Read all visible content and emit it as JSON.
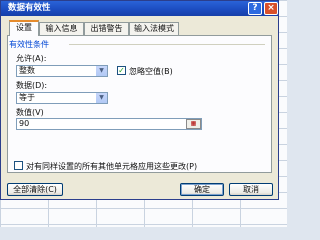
{
  "window": {
    "title": "数据有效性",
    "help_glyph": "?",
    "close_glyph": "×"
  },
  "tabs": [
    {
      "label": "设置"
    },
    {
      "label": "输入信息"
    },
    {
      "label": "出错警告"
    },
    {
      "label": "输入法模式"
    }
  ],
  "validity": {
    "group_label": "有效性条件",
    "allow_label": "允许(A):",
    "allow_value": "整数",
    "ignore_blank_label": "忽略空值(B)",
    "ignore_blank_checked": true,
    "data_label": "数据(D):",
    "data_value": "等于",
    "value_label": "数值(V)",
    "value_input": "90"
  },
  "apply_all": {
    "label": "对有同样设置的所有其他单元格应用这些更改(P)",
    "checked": false
  },
  "buttons": {
    "clear_all": "全部清除(C)",
    "ok": "确定",
    "cancel": "取消"
  },
  "icons": {
    "dropdown": "chevron-down-icon",
    "range_picker": "range-select-icon",
    "check": "checkmark-icon"
  }
}
